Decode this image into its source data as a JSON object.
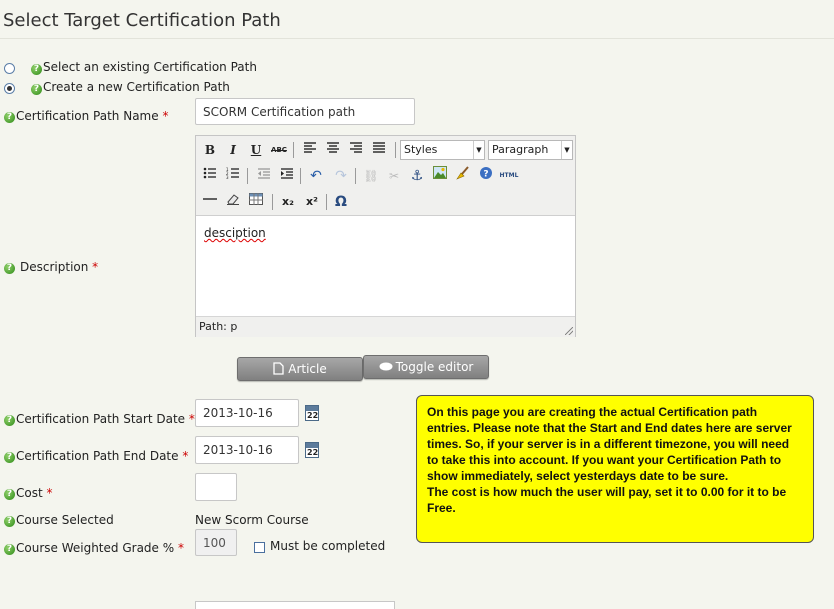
{
  "page": {
    "title": "Select Target Certification Path"
  },
  "path_choice": {
    "existing_label": "Select an existing Certification Path",
    "new_label": "Create a new Certification Path",
    "selected": "new"
  },
  "form": {
    "required_mark": "*",
    "name_label": "Certification Path Name",
    "name_value": "SCORM Certification path",
    "description_label": "Description",
    "start_label": "Certification Path Start Date",
    "start_value": "2013-10-16",
    "end_label": "Certification Path End Date",
    "end_value": "2013-10-16",
    "cost_label": "Cost",
    "cost_value": "",
    "course_label": "Course Selected",
    "course_value": "New Scorm Course",
    "grade_label": "Course Weighted Grade %",
    "grade_value": "100",
    "must_complete_label": "Must be completed",
    "calendar_day": "22"
  },
  "editor": {
    "styles_select": "Styles",
    "paragraph_select": "Paragraph",
    "content": "desciption",
    "path": "Path: p",
    "buttons": {
      "bold": "B",
      "italic": "I",
      "underline": "U",
      "strikethrough": "ABC",
      "subscript": "x₂",
      "superscript": "x²",
      "omega": "Ω",
      "html": "HTML"
    }
  },
  "buttons": {
    "article": "Article",
    "toggle_editor": "Toggle editor"
  },
  "note": {
    "text": "On this page you are creating the actual Certification path entries.  Please note that the Start and End dates here are server times. So, if your server is in a different timezone, you will need to take this into account.  If you want your Certification Path to show immediately, select yesterdays date to be sure.\nThe cost is how much the user will pay, set it to 0.00 for it to be Free.",
    "bg_color": "#ffff00"
  },
  "colors": {
    "help_icon": "#3a9a1e",
    "required": "#cc0000",
    "button": "#8f8f8f"
  }
}
